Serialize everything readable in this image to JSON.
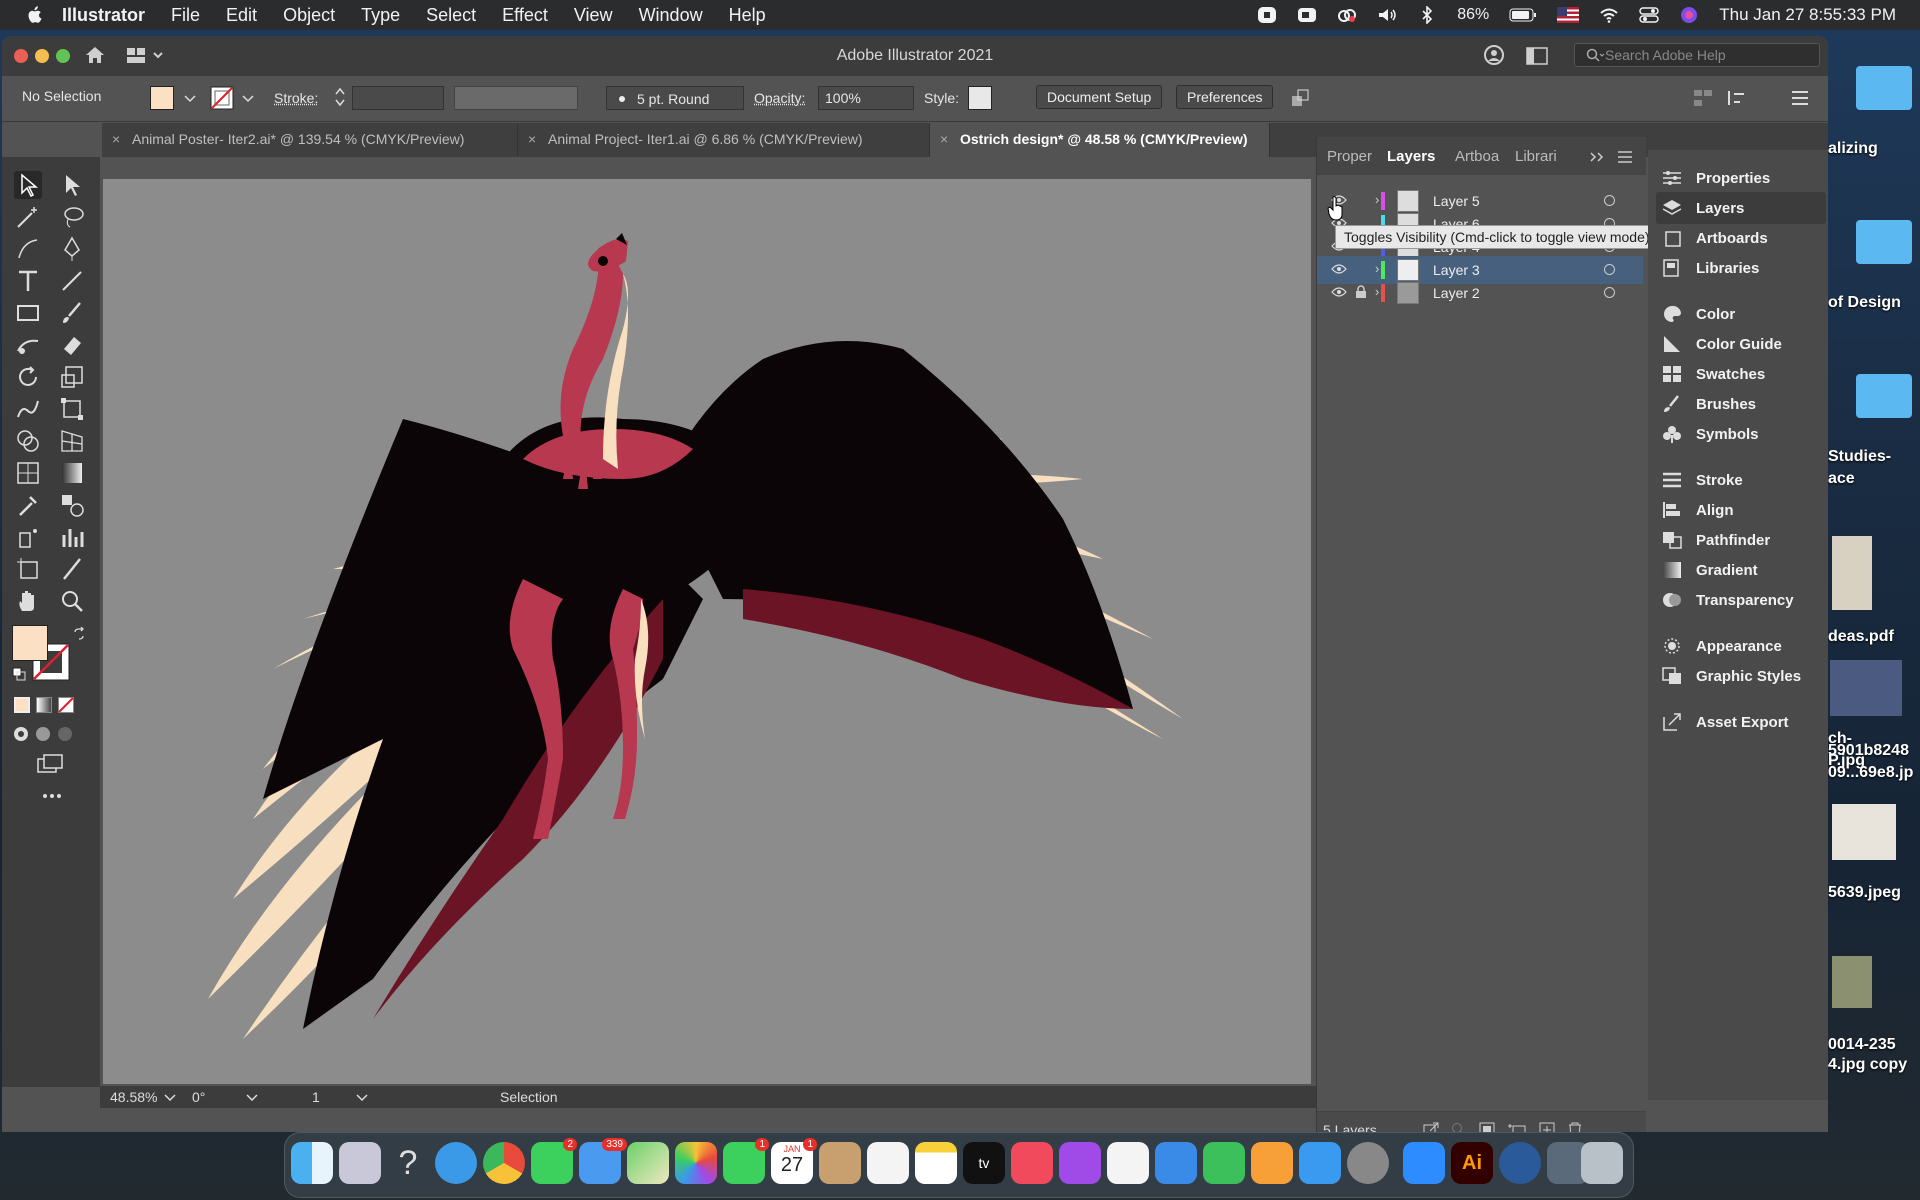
{
  "menubar": {
    "app_name": "Illustrator",
    "items": [
      "File",
      "Edit",
      "Object",
      "Type",
      "Select",
      "Effect",
      "View",
      "Window",
      "Help"
    ],
    "battery": "86%",
    "datetime": "Thu Jan 27  8:55:33 PM"
  },
  "window": {
    "title": "Adobe Illustrator 2021",
    "search_placeholder": "Search Adobe Help"
  },
  "control_bar": {
    "selection": "No Selection",
    "stroke_label": "Stroke:",
    "brush": "5 pt. Round",
    "opacity_label": "Opacity:",
    "opacity_value": "100%",
    "style_label": "Style:",
    "document_setup": "Document Setup",
    "preferences": "Preferences"
  },
  "tabs": [
    {
      "label": "Animal Poster- Iter2.ai* @ 139.54 % (CMYK/Preview)"
    },
    {
      "label": "Animal Project- Iter1.ai @ 6.86 % (CMYK/Preview)"
    },
    {
      "label": "Ostrich design* @ 48.58 % (CMYK/Preview)"
    }
  ],
  "layers_panel": {
    "tabs": [
      "Proper",
      "Layers",
      "Artboa",
      "Librari"
    ],
    "layers": [
      {
        "name": "Layer 5",
        "color": "#d84fe8"
      },
      {
        "name": "Layer 6",
        "color": "#4fd9e8"
      },
      {
        "name": "Layer 4",
        "color": "#4f5de8"
      },
      {
        "name": "Layer 3",
        "color": "#4fe85a"
      },
      {
        "name": "Layer 2",
        "color": "#e84f4f"
      }
    ],
    "tooltip": "Toggles Visibility (Cmd-click to toggle view mode)",
    "footer_count": "5 Layers"
  },
  "side_dock": {
    "items": [
      "Properties",
      "Layers",
      "Artboards",
      "Libraries",
      "Color",
      "Color Guide",
      "Swatches",
      "Brushes",
      "Symbols",
      "Stroke",
      "Align",
      "Pathfinder",
      "Gradient",
      "Transparency",
      "Appearance",
      "Graphic Styles",
      "Asset Export"
    ]
  },
  "status_bar": {
    "zoom": "48.58%",
    "rotation": "0°",
    "artboard": "1",
    "tool": "Selection"
  },
  "desktop": {
    "labels": [
      "alizing",
      "of Design",
      "Studies-",
      "ace",
      "deas.pdf",
      "ch-",
      "5901b8248",
      "P.jpg",
      "09...69e8.jp",
      "5639.jpeg",
      "0014-235",
      "4.jpg copy"
    ]
  },
  "dock": {
    "mail_badge": "339",
    "messages_badge": "2",
    "calendar_badge": "1",
    "facetime_badge": "1",
    "calendar_month": "JAN",
    "calendar_day": "27",
    "ai_label": "Ai"
  },
  "colors": {
    "fill_swatch": "#fbe0c4",
    "accent_selection": "#46607e",
    "ostrich_pink": "#b8384f",
    "feather": "#f8dfc0",
    "wing_dark": "#0c0507",
    "wing_maroon": "#6b1426"
  }
}
